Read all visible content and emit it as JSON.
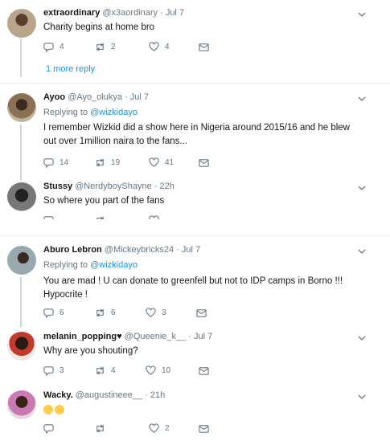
{
  "tweets": [
    {
      "name": "extraordinary",
      "handle": "@x3aordinary",
      "time": "· Jul 7",
      "text": "Charity begins at home bro",
      "reply_count": "4",
      "retweet_count": "2",
      "like_count": "4",
      "more_replies": "1 more reply"
    },
    {
      "name": "Ayoo",
      "handle": "@Ayo_olukya",
      "time": "· Jul 7",
      "replying_prefix": "Replying to",
      "replying_to": "@wizkidayo",
      "text": "I remember Wizkid did a show here in Nigeria around 2015/16 and he blew out over 1million naira to the fans...",
      "reply_count": "14",
      "retweet_count": "19",
      "like_count": "41"
    },
    {
      "name": "Stussy",
      "handle": "@NerdyboyShayne",
      "time": "· 22h",
      "text": "So where you part of the fans"
    },
    {
      "name": "Aburo Lebron",
      "handle": "@Mickeybricks24",
      "time": "· Jul 7",
      "replying_prefix": "Replying to",
      "replying_to": "@wizkidayo",
      "text": "You are mad ! U can donate to greenfell but not to IDP camps in Borno !!! Hypocrite !",
      "reply_count": "6",
      "retweet_count": "6",
      "like_count": "3"
    },
    {
      "name": "melanin_popping",
      "handle": "@Queenie_k__",
      "time": "· Jul 7",
      "text": "Why are you shouting?",
      "reply_count": "3",
      "retweet_count": "4",
      "like_count": "10"
    },
    {
      "name": "Wacky.",
      "handle": "@augustineee__",
      "time": "· 21h",
      "like_count": "2"
    }
  ],
  "colors": {
    "link": "#1b95e0",
    "muted": "#657786",
    "border": "#e6ecf0",
    "thread": "#ccd6dd"
  }
}
